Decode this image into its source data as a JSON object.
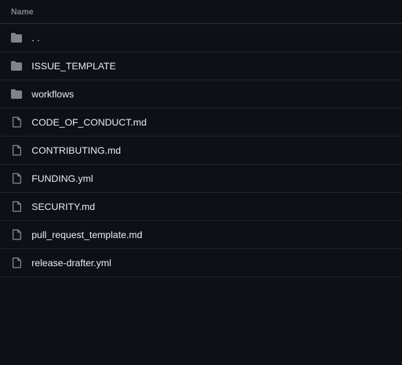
{
  "table": {
    "header": "Name",
    "entries": [
      {
        "type": "dir",
        "name": ". ."
      },
      {
        "type": "dir",
        "name": "ISSUE_TEMPLATE"
      },
      {
        "type": "dir",
        "name": "workflows"
      },
      {
        "type": "file",
        "name": "CODE_OF_CONDUCT.md"
      },
      {
        "type": "file",
        "name": "CONTRIBUTING.md"
      },
      {
        "type": "file",
        "name": "FUNDING.yml"
      },
      {
        "type": "file",
        "name": "SECURITY.md"
      },
      {
        "type": "file",
        "name": "pull_request_template.md"
      },
      {
        "type": "file",
        "name": "release-drafter.yml"
      }
    ]
  }
}
